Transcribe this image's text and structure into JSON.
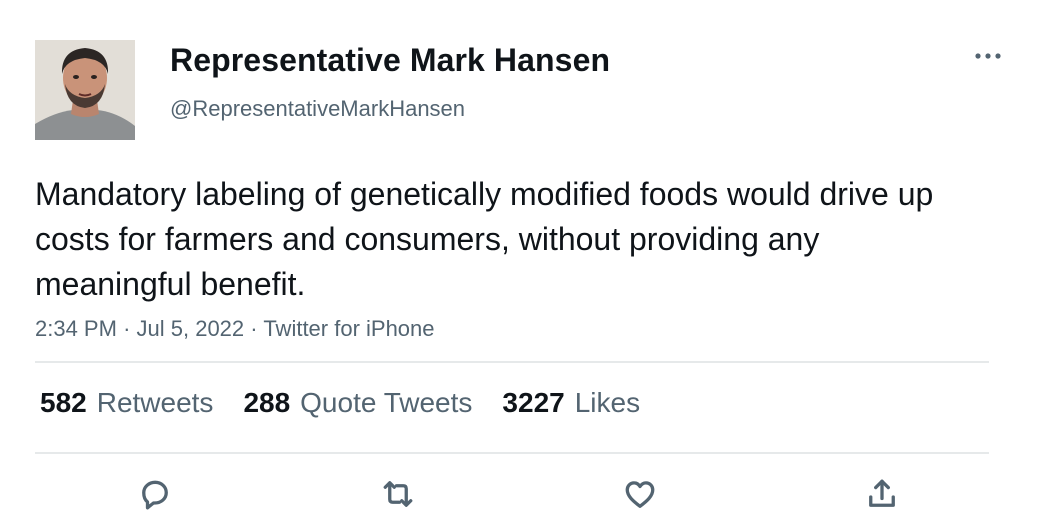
{
  "author": {
    "display_name": "Representative Mark Hansen",
    "handle": "@RepresentativeMarkHansen",
    "avatar_icon": "profile-photo"
  },
  "tweet": {
    "text": "Mandatory labeling of genetically modified foods would drive up costs for farmers and consumers, without providing any meaningful benefit.",
    "time": "2:34 PM",
    "date": "Jul 5, 2022",
    "source": "Twitter for iPhone",
    "separator": "·"
  },
  "stats": {
    "retweets": {
      "count": "582",
      "label": "Retweets"
    },
    "quote_tweets": {
      "count": "288",
      "label": "Quote Tweets"
    },
    "likes": {
      "count": "3227",
      "label": "Likes"
    }
  },
  "actions": {
    "reply_icon": "reply-icon",
    "retweet_icon": "retweet-icon",
    "like_icon": "heart-icon",
    "share_icon": "share-icon"
  },
  "more_icon": "more-options-icon",
  "colors": {
    "text_primary": "#0f1419",
    "text_secondary": "#536471",
    "divider": "#e6e9ea",
    "background": "#ffffff"
  }
}
